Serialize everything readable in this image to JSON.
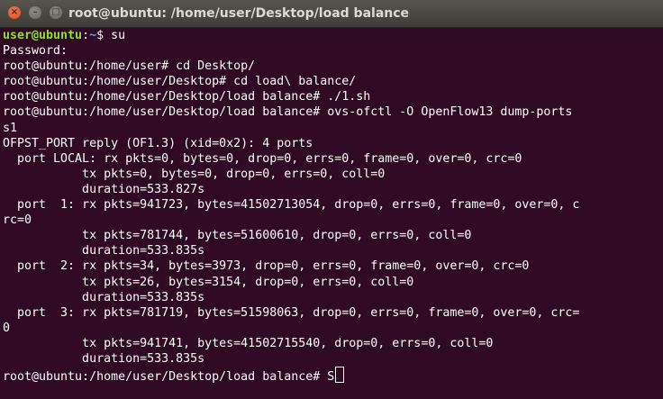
{
  "window": {
    "title": "root@ubuntu: /home/user/Desktop/load balance",
    "close_glyph": "×",
    "min_glyph": "–",
    "max_glyph": "□"
  },
  "terminal": {
    "prompt_user": {
      "userhost": "user@ubuntu",
      "colon": ":",
      "path": "~",
      "rest": "$ su"
    },
    "lines": [
      "Password:",
      "root@ubuntu:/home/user# cd Desktop/",
      "root@ubuntu:/home/user/Desktop# cd load\\ balance/",
      "root@ubuntu:/home/user/Desktop/load balance# ./1.sh",
      "root@ubuntu:/home/user/Desktop/load balance# ovs-ofctl -O OpenFlow13 dump-ports",
      "s1",
      "OFPST_PORT reply (OF1.3) (xid=0x2): 4 ports",
      "  port LOCAL: rx pkts=0, bytes=0, drop=0, errs=0, frame=0, over=0, crc=0",
      "           tx pkts=0, bytes=0, drop=0, errs=0, coll=0",
      "           duration=533.827s",
      "  port  1: rx pkts=941723, bytes=41502713054, drop=0, errs=0, frame=0, over=0, c",
      "rc=0",
      "           tx pkts=781744, bytes=51600610, drop=0, errs=0, coll=0",
      "           duration=533.835s",
      "  port  2: rx pkts=34, bytes=3973, drop=0, errs=0, frame=0, over=0, crc=0",
      "           tx pkts=26, bytes=3154, drop=0, errs=0, coll=0",
      "           duration=533.835s",
      "  port  3: rx pkts=781719, bytes=51598063, drop=0, errs=0, frame=0, over=0, crc=",
      "0",
      "           tx pkts=941741, bytes=41502715540, drop=0, errs=0, coll=0",
      "           duration=533.835s"
    ],
    "last_prompt": "root@ubuntu:/home/user/Desktop/load balance# S"
  },
  "colors": {
    "background": "#300a24",
    "titlebar": "#4a4944",
    "text": "#ffffff",
    "user_prompt": "#8ae234",
    "path_prompt": "#729fcf",
    "close_button": "#e2582b"
  }
}
